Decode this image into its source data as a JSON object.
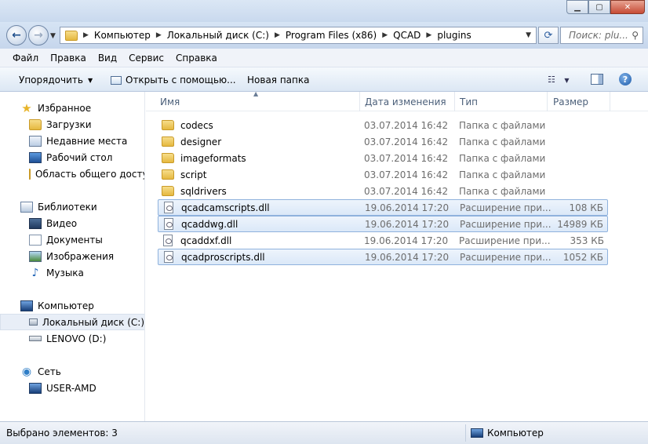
{
  "address": {
    "segments": [
      "Компьютер",
      "Локальный диск (C:)",
      "Program Files (x86)",
      "QCAD",
      "plugins"
    ]
  },
  "search": {
    "placeholder": "Поиск: plu..."
  },
  "menu": [
    "Файл",
    "Правка",
    "Вид",
    "Сервис",
    "Справка"
  ],
  "toolbar": {
    "organize": "Упорядочить",
    "open_with": "Открыть с помощью...",
    "new_folder": "Новая папка"
  },
  "nav": {
    "favorites": "Избранное",
    "downloads": "Загрузки",
    "recent": "Недавние места",
    "desktop": "Рабочий стол",
    "shared": "Область общего досту",
    "libraries": "Библиотеки",
    "video": "Видео",
    "documents": "Документы",
    "images": "Изображения",
    "music": "Музыка",
    "computer": "Компьютер",
    "local_disk": "Локальный диск (C:)",
    "lenovo": "LENOVO (D:)",
    "network": "Сеть",
    "user_amd": "USER-AMD"
  },
  "columns": {
    "name": "Имя",
    "date": "Дата изменения",
    "type": "Тип",
    "size": "Размер"
  },
  "files": [
    {
      "name": "codecs",
      "date": "03.07.2014 16:42",
      "type": "Папка с файлами",
      "size": "",
      "kind": "folder",
      "selected": false
    },
    {
      "name": "designer",
      "date": "03.07.2014 16:42",
      "type": "Папка с файлами",
      "size": "",
      "kind": "folder",
      "selected": false
    },
    {
      "name": "imageformats",
      "date": "03.07.2014 16:42",
      "type": "Папка с файлами",
      "size": "",
      "kind": "folder",
      "selected": false
    },
    {
      "name": "script",
      "date": "03.07.2014 16:42",
      "type": "Папка с файлами",
      "size": "",
      "kind": "folder",
      "selected": false
    },
    {
      "name": "sqldrivers",
      "date": "03.07.2014 16:42",
      "type": "Папка с файлами",
      "size": "",
      "kind": "folder",
      "selected": false
    },
    {
      "name": "qcadcamscripts.dll",
      "date": "19.06.2014 17:20",
      "type": "Расширение при...",
      "size": "108 КБ",
      "kind": "dll",
      "selected": true
    },
    {
      "name": "qcaddwg.dll",
      "date": "19.06.2014 17:20",
      "type": "Расширение при...",
      "size": "14989 КБ",
      "kind": "dll",
      "selected": true
    },
    {
      "name": "qcaddxf.dll",
      "date": "19.06.2014 17:20",
      "type": "Расширение при...",
      "size": "353 КБ",
      "kind": "dll",
      "selected": false
    },
    {
      "name": "qcadproscripts.dll",
      "date": "19.06.2014 17:20",
      "type": "Расширение при...",
      "size": "1052 КБ",
      "kind": "dll",
      "selected": true
    }
  ],
  "status": {
    "selected": "Выбрано элементов: 3",
    "location": "Компьютер"
  }
}
